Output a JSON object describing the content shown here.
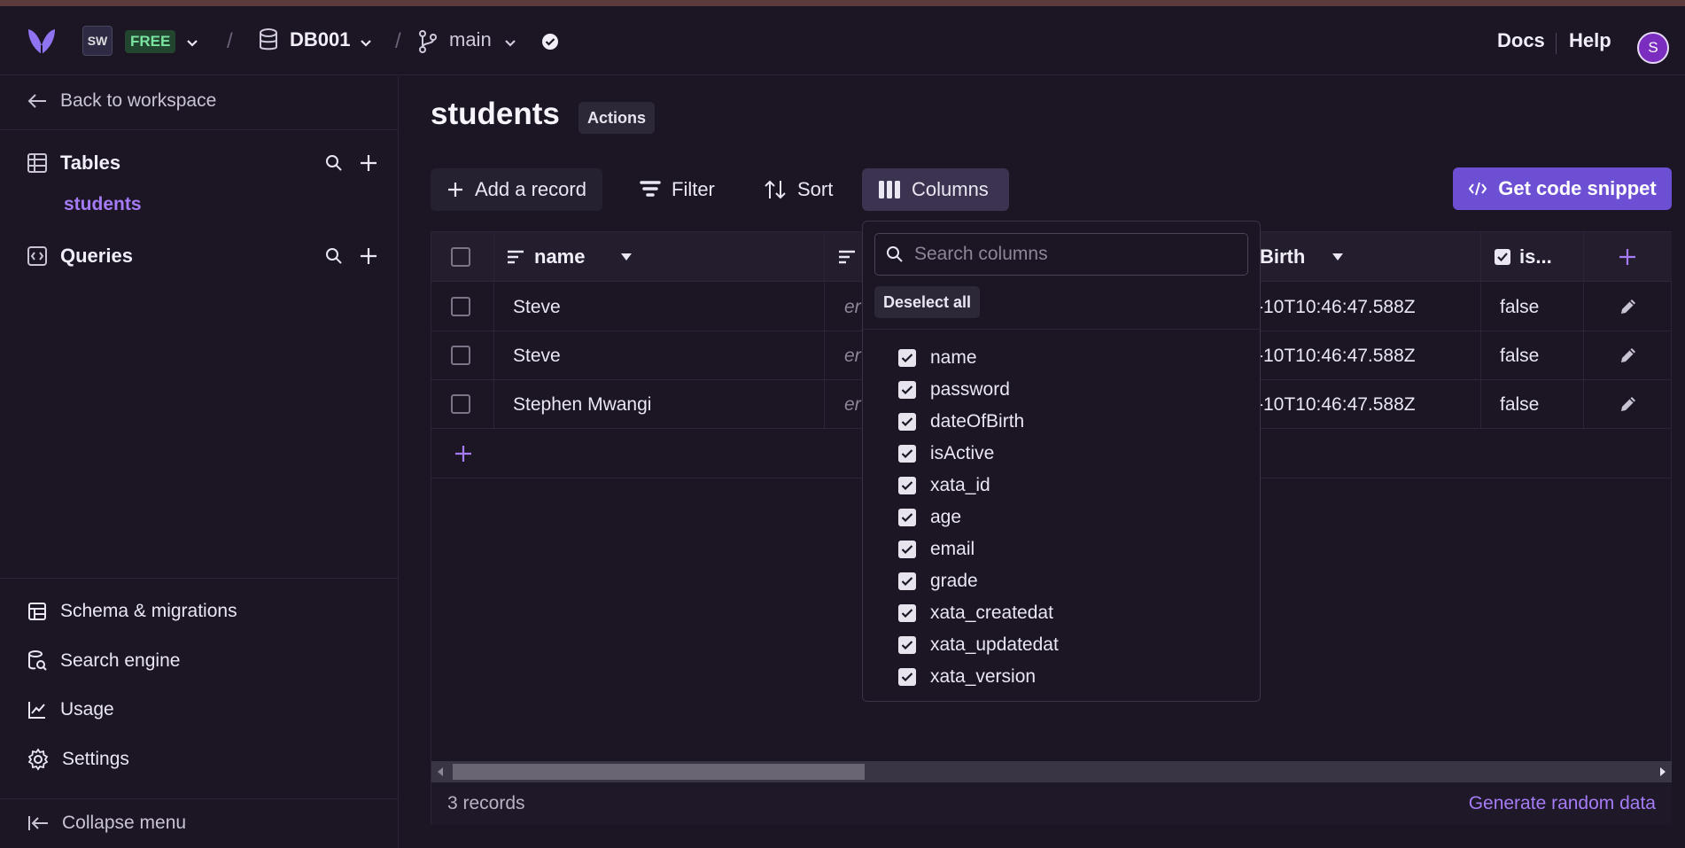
{
  "topbar": {
    "workspace_initials": "SW",
    "plan": "FREE",
    "separator": "/",
    "database": "DB001",
    "branch": "main",
    "docs": "Docs",
    "help": "Help",
    "avatar_initial": "S"
  },
  "sidebar": {
    "back": "Back to workspace",
    "tables_heading": "Tables",
    "tables": [
      "students"
    ],
    "queries_heading": "Queries",
    "bottom_items": [
      {
        "label": "Schema & migrations",
        "icon": "schema-icon"
      },
      {
        "label": "Search engine",
        "icon": "search-engine-icon"
      },
      {
        "label": "Usage",
        "icon": "usage-chart-icon"
      },
      {
        "label": "Settings",
        "icon": "gear-icon"
      }
    ],
    "collapse": "Collapse menu"
  },
  "main": {
    "title": "students",
    "actions_label": "Actions",
    "toolbar": {
      "add_record": "Add a record",
      "filter": "Filter",
      "sort": "Sort",
      "columns": "Columns",
      "snippet": "Get code snippet"
    },
    "table": {
      "headers": {
        "name": "name",
        "date": "Birth",
        "active": "is..."
      },
      "rows": [
        {
          "name": "Steve",
          "partial": "er",
          "date": "-10T10:46:47.588Z",
          "active": "false"
        },
        {
          "name": "Steve",
          "partial": "er",
          "date": "-10T10:46:47.588Z",
          "active": "false"
        },
        {
          "name": "Stephen Mwangi",
          "partial": "er",
          "date": "-10T10:46:47.588Z",
          "active": "false"
        }
      ],
      "record_count": "3 records",
      "generate": "Generate random data"
    }
  },
  "columns_popover": {
    "search_placeholder": "Search columns",
    "deselect_all": "Deselect all",
    "columns": [
      "name",
      "password",
      "dateOfBirth",
      "isActive",
      "xata_id",
      "age",
      "email",
      "grade",
      "xata_createdat",
      "xata_updatedat",
      "xata_version"
    ]
  },
  "colors": {
    "accent": "#a57cf5",
    "primary_button": "#6d4fd4",
    "background": "#1b1524"
  }
}
